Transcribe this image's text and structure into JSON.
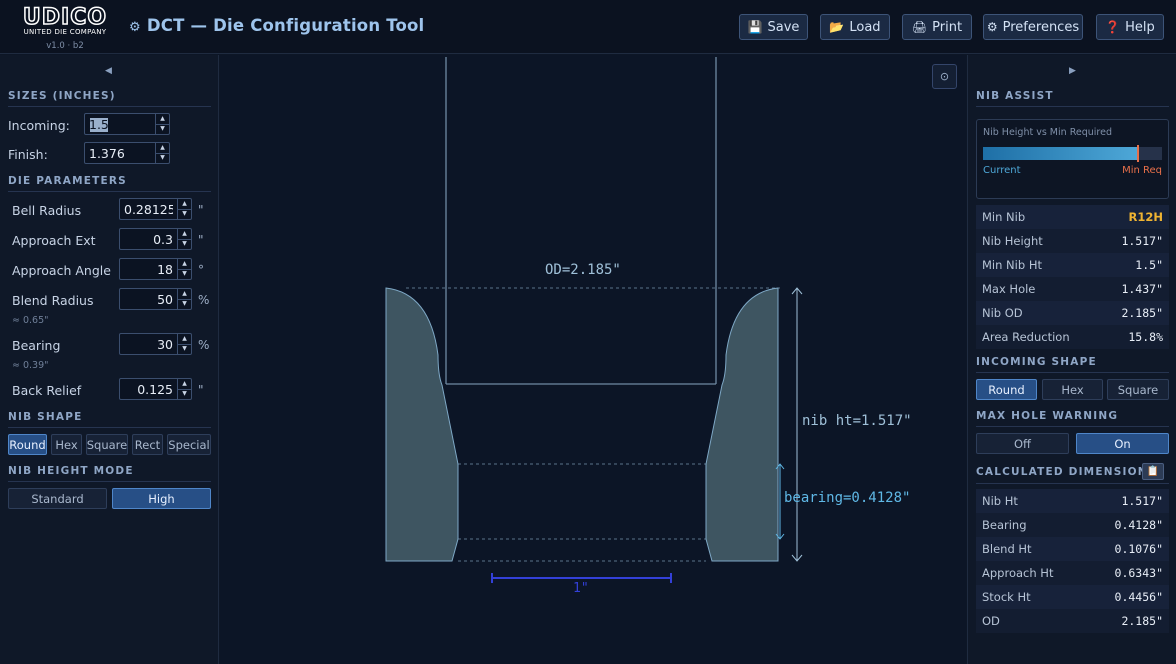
{
  "header": {
    "logo_text": "UDICO",
    "logo_sub": "UNITED DIE COMPANY",
    "version": "v1.0 · b2",
    "title": "DCT — Die Configuration Tool",
    "buttons": [
      {
        "label": "Save",
        "icon": "save-icon"
      },
      {
        "label": "Load",
        "icon": "folder-icon"
      },
      {
        "label": "Print",
        "icon": "printer-icon"
      },
      {
        "label": "Preferences",
        "icon": "gear-icon"
      },
      {
        "label": "Help",
        "icon": "help-icon"
      }
    ]
  },
  "left": {
    "sizes_title": "SIZES (INCHES)",
    "incoming_label": "Incoming:",
    "incoming_value": "1.5",
    "finish_label": "Finish:",
    "finish_value": "1.376",
    "die_params_title": "DIE PARAMETERS",
    "params": [
      {
        "label": "Bell Radius",
        "value": "0.28125",
        "unit": "\"",
        "sub": ""
      },
      {
        "label": "Approach Ext",
        "value": "0.3",
        "unit": "\"",
        "sub": ""
      },
      {
        "label": "Approach Angle",
        "value": "18",
        "unit": "°",
        "sub": ""
      },
      {
        "label": "Blend Radius",
        "value": "50",
        "unit": "%",
        "sub": "≈ 0.65\""
      },
      {
        "label": "Bearing",
        "value": "30",
        "unit": "%",
        "sub": "≈ 0.39\""
      },
      {
        "label": "Back Relief",
        "value": "0.125",
        "unit": "\"",
        "sub": ""
      }
    ],
    "nib_shape_title": "NIB SHAPE",
    "nib_shapes": [
      "Round",
      "Hex",
      "Square",
      "Rect",
      "Special"
    ],
    "nib_shape_selected": "Round",
    "nib_height_title": "NIB HEIGHT MODE",
    "height_modes": [
      "Standard",
      "High"
    ],
    "height_mode_selected": "High"
  },
  "drawing": {
    "od_label": "OD=2.185\"",
    "nib_ht_label": "nib ht=1.517\"",
    "bearing_label": "bearing=0.4128\"",
    "scale_label": "1\"",
    "colors": {
      "nib_fill": "#3e5561",
      "outline": "#7ea8c6",
      "dim": "#9fc0d8",
      "bearing": "#5fb8e6",
      "scale": "#3340d8"
    }
  },
  "right": {
    "assist_title": "NIB ASSIST",
    "assist_chart_title": "Nib Height vs Min Required",
    "assist_current_label": "Current",
    "assist_min_label": "Min Req",
    "assist_current_fraction": 0.87,
    "assist_min_fraction": 0.86,
    "metrics": [
      {
        "label": "Min Nib",
        "value": "R12H"
      },
      {
        "label": "Nib Height",
        "value": "1.517\""
      },
      {
        "label": "Min Nib Ht",
        "value": "1.5\""
      },
      {
        "label": "Max Hole",
        "value": "1.437\""
      },
      {
        "label": "Nib OD",
        "value": "2.185\""
      },
      {
        "label": "Area Reduction",
        "value": "15.8%"
      }
    ],
    "incoming_shape_title": "INCOMING SHAPE",
    "incoming_shapes": [
      "Round",
      "Hex",
      "Square"
    ],
    "incoming_shape_selected": "Round",
    "max_hole_title": "MAX HOLE WARNING",
    "max_hole_options": [
      "Off",
      "On"
    ],
    "max_hole_selected": "On",
    "calc_title": "CALCULATED DIMENSIONS",
    "calc": [
      {
        "label": "Nib Ht",
        "value": "1.517\""
      },
      {
        "label": "Bearing",
        "value": "0.4128\""
      },
      {
        "label": "Blend Ht",
        "value": "0.1076\""
      },
      {
        "label": "Approach Ht",
        "value": "0.6343\""
      },
      {
        "label": "Stock Ht",
        "value": "0.4456\""
      },
      {
        "label": "OD",
        "value": "2.185\""
      }
    ]
  }
}
